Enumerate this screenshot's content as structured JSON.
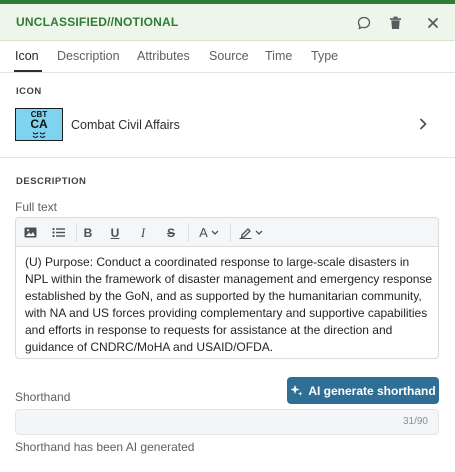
{
  "header": {
    "classification": "UNCLASSIFIED//NOTIONAL",
    "accent_color": "#2e7d32",
    "buttons": [
      {
        "name": "comment-icon"
      },
      {
        "name": "trash-icon"
      },
      {
        "name": "close-icon"
      }
    ]
  },
  "tabs": [
    {
      "label": "Icon",
      "active": true
    },
    {
      "label": "Description",
      "active": false
    },
    {
      "label": "Attributes",
      "active": false
    },
    {
      "label": "Source",
      "active": false
    },
    {
      "label": "Time",
      "active": false
    },
    {
      "label": "Type",
      "active": false
    }
  ],
  "icon_section": {
    "label": "ICON",
    "unit_symbol": {
      "top": "CBT",
      "main": "CA",
      "fill_color": "#7fd3ee"
    },
    "unit_name": "Combat Civil Affairs",
    "chevron": "chevron-right-icon"
  },
  "description": {
    "label": "DESCRIPTION",
    "full_text_label": "Full text",
    "toolbar": [
      "image-icon",
      "bulleted-list-icon",
      "bold-icon",
      "underline-icon",
      "italic-icon",
      "strikethrough-icon",
      "text-color-icon",
      "highlight-icon"
    ],
    "bold_glyph": "B",
    "underline_glyph": "U",
    "italic_glyph": "I",
    "strike_glyph": "S",
    "font_color_glyph": "A",
    "full_text": "(U) Purpose: Conduct a coordinated response to large-scale disasters in NPL within the framework of disaster management and emergency response established by the GoN, and as supported by the humanitarian community, with NA and US forces providing complementary and supportive capabilities and efforts in response to requests for assistance at the direction and guidance of CNDRC/MoHA and USAID/OFDA."
  },
  "shorthand": {
    "ai_button_label": "AI generate shorthand",
    "ai_button_color": "#2f6f96",
    "label": "Shorthand",
    "value": "",
    "counter": "31/90",
    "note": "Shorthand has been AI generated"
  }
}
